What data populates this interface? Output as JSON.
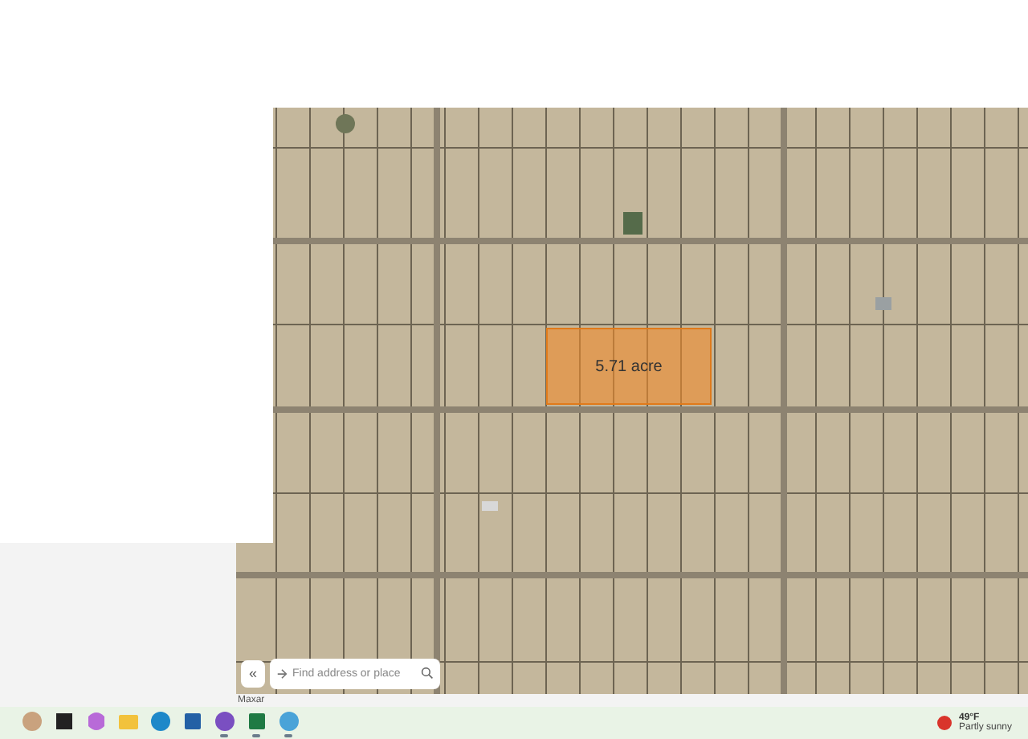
{
  "map": {
    "parcel": {
      "label": "5.71 acre"
    },
    "collapse_button": {
      "label": "«"
    },
    "search": {
      "placeholder": "Find address or place"
    },
    "attribution": "Maxar"
  },
  "taskbar": {
    "apps": [
      {
        "kind": "avatar",
        "running": false
      },
      {
        "kind": "terminal",
        "running": false
      },
      {
        "kind": "copilot",
        "running": false
      },
      {
        "kind": "folder",
        "running": false
      },
      {
        "kind": "edge",
        "running": false
      },
      {
        "kind": "store",
        "running": false
      },
      {
        "kind": "chrome",
        "running": true
      },
      {
        "kind": "excel",
        "running": true
      },
      {
        "kind": "globe",
        "running": true
      }
    ],
    "weather": {
      "temperature": "49°F",
      "condition": "Partly sunny"
    }
  }
}
